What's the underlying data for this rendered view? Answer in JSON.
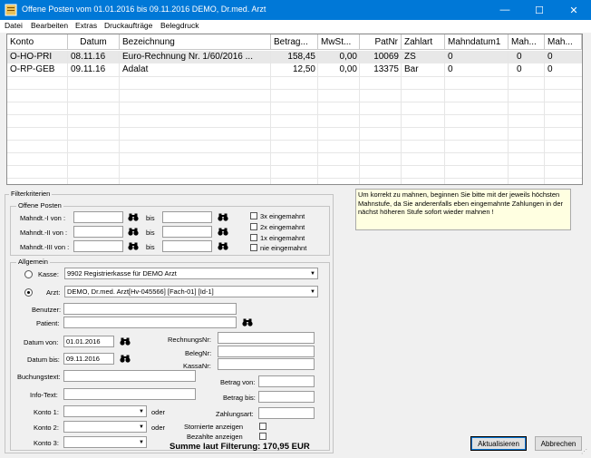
{
  "window": {
    "title": "Offene Posten vom 01.01.2016 bis 09.11.2016 DEMO, Dr.med. Arzt",
    "minimize": "—",
    "maximize": "☐",
    "close": "✕"
  },
  "menu": [
    "Datei",
    "Bearbeiten",
    "Extras",
    "Druckaufträge",
    "Belegdruck"
  ],
  "table": {
    "columns": [
      "Konto",
      "Datum",
      "Bezeichnung",
      "Betrag...",
      "MwSt...",
      "PatNr",
      "Zahlart",
      "Mahndatum1",
      "Mah...",
      "Mah..."
    ],
    "rows": [
      [
        "O-HO-PRI",
        "08.11.16",
        "Euro-Rechnung Nr. 1/60/2016 ...",
        "158,45",
        "0,00",
        "10069",
        "ZS",
        "0",
        "0",
        "0"
      ],
      [
        "O-RP-GEB",
        "09.11.16",
        "Adalat",
        "12,50",
        "0,00",
        "13375",
        "Bar",
        "0",
        "0",
        "0"
      ]
    ]
  },
  "filter": {
    "title": "Filterkriterien",
    "open_items": {
      "title": "Offene Posten",
      "rows": [
        {
          "label": "Mahndt.-I von :",
          "bis": "bis"
        },
        {
          "label": "Mahndt.-II von :",
          "bis": "bis"
        },
        {
          "label": "Mahndt.-III von :",
          "bis": "bis"
        }
      ],
      "checks": [
        "3x eingemahnt",
        "2x eingemahnt",
        "1x eingemahnt",
        "nie eingemahnt"
      ]
    },
    "general": {
      "title": "Allgemein",
      "kasse_label": "Kasse:",
      "kasse_value": "9902  Registrierkasse für DEMO Arzt",
      "arzt_label": "Arzt:",
      "arzt_value": "DEMO, Dr.med. Arzt[Hv-045566] [Fach-01] [Id-1]",
      "benutzer_label": "Benutzer:",
      "patient_label": "Patient:",
      "datum_von_label": "Datum von:",
      "datum_von_value": "01.01.2016",
      "datum_bis_label": "Datum bis:",
      "datum_bis_value": "09.11.2016",
      "rechnungsnr_label": "RechnungsNr:",
      "belegnr_label": "BelegNr:",
      "kassanr_label": "KassaNr:",
      "buchungstext_label": "Buchungstext:",
      "infotext_label": "Info-Text:",
      "betrag_von_label": "Betrag von:",
      "betrag_bis_label": "Betrag bis:",
      "zahlungsart_label": "Zahlungsart:",
      "konto1_label": "Konto 1:",
      "konto2_label": "Konto 2:",
      "konto3_label": "Konto 3:",
      "oder": "oder",
      "storniert_label": "Stornierte anzeigen",
      "bezahlt_label": "Bezahlte anzeigen",
      "summe": "Summe laut Filterung: 170,95 EUR"
    }
  },
  "note": "Um korrekt zu mahnen, beginnen Sie bitte mit der jeweils höchsten Mahnstufe, da Sie anderenfalls eben eingemahnte Zahlungen in der nächst höheren Stufe sofort wieder mahnen !",
  "buttons": {
    "refresh": "Aktualisieren",
    "cancel": "Abbrechen"
  },
  "colors": {
    "titlebar": "#0078d7",
    "note_bg": "#ffffe1"
  }
}
